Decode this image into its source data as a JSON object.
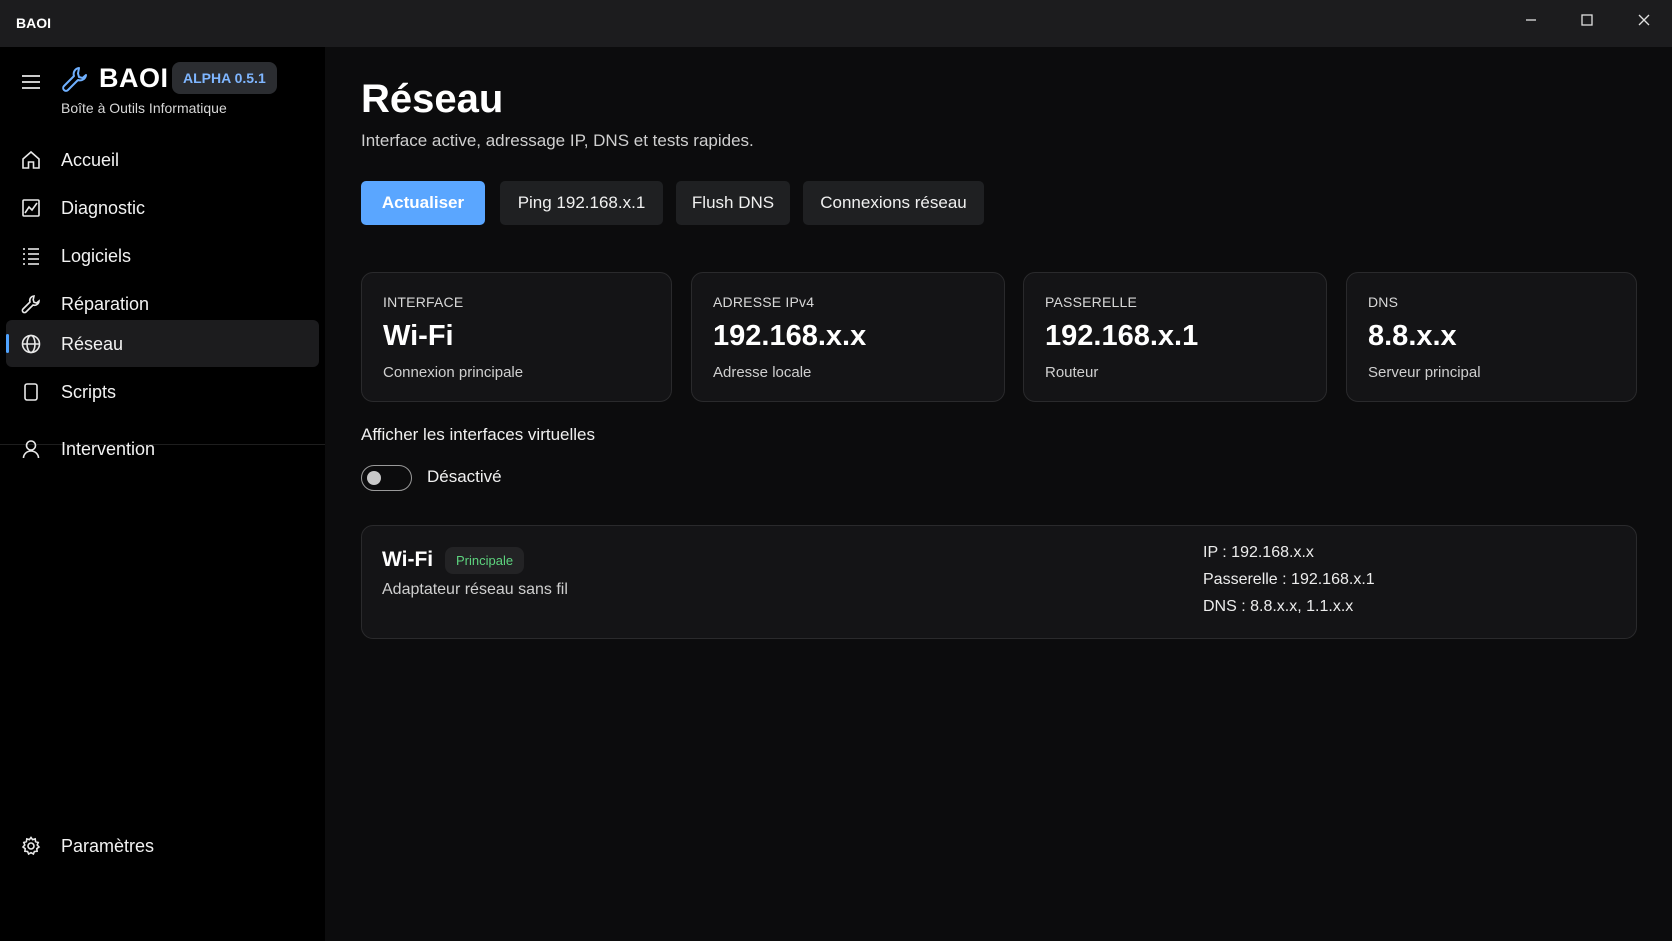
{
  "window": {
    "title": "BAOI",
    "controls": [
      "minimize-icon",
      "maximize-icon",
      "close-icon"
    ]
  },
  "sidebar": {
    "brand": {
      "name": "BAOI",
      "version": "ALPHA 0.5.1",
      "subtitle": "Boîte à Outils Informatique"
    },
    "items": [
      {
        "label": "Accueil",
        "icon": "home-icon"
      },
      {
        "label": "Diagnostic",
        "icon": "chart-icon"
      },
      {
        "label": "Logiciels",
        "icon": "list-icon"
      },
      {
        "label": "Réparation",
        "icon": "wrench-icon"
      },
      {
        "label": "Réseau",
        "icon": "globe-icon",
        "active": true
      },
      {
        "label": "Scripts",
        "icon": "document-icon"
      },
      {
        "label": "Intervention",
        "icon": "person-icon"
      }
    ],
    "footer": {
      "label": "Paramètres",
      "icon": "gear-icon"
    }
  },
  "main": {
    "title": "Réseau",
    "subtitle": "Interface active, adressage IP, DNS et tests rapides.",
    "actions": [
      {
        "label": "Actualiser",
        "primary": true
      },
      {
        "label": "Ping 192.168.x.1"
      },
      {
        "label": "Flush DNS"
      },
      {
        "label": "Connexions réseau"
      }
    ],
    "cards": [
      {
        "label": "INTERFACE",
        "value": "Wi-Fi",
        "sub": "Connexion principale"
      },
      {
        "label": "ADRESSE IPv4",
        "value": "192.168.x.x",
        "sub": "Adresse locale"
      },
      {
        "label": "PASSERELLE",
        "value": "192.168.x.1",
        "sub": "Routeur"
      },
      {
        "label": "DNS",
        "value": "8.8.x.x",
        "sub": "Serveur principal"
      }
    ],
    "virtual_toggle": {
      "title": "Afficher les interfaces virtuelles",
      "state": "Désactivé",
      "on": false
    },
    "interface": {
      "name": "Wi-Fi",
      "badge": "Principale",
      "description": "Adaptateur réseau sans fil",
      "details": [
        "IP : 192.168.x.x",
        "Passerelle : 192.168.x.1",
        "DNS : 8.8.x.x, 1.1.x.x"
      ]
    }
  },
  "colors": {
    "accent": "#5aa6ff",
    "badge_text": "#7fb6ff",
    "status_green": "#5dd37e",
    "background": "#0c0c0d",
    "card": "#141416"
  }
}
